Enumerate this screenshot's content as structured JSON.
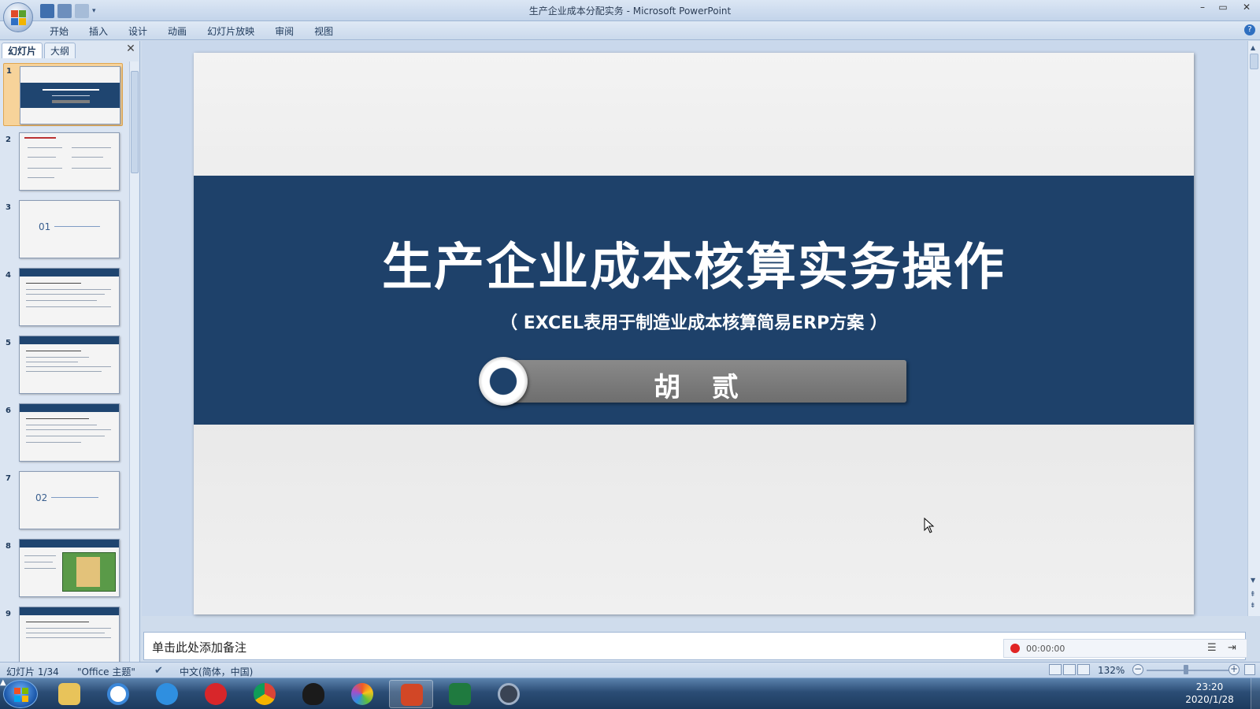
{
  "window": {
    "title": "生产企业成本分配实务 - Microsoft PowerPoint",
    "controls": [
      "–",
      "▭",
      "✕"
    ]
  },
  "ribbon": {
    "tabs": [
      "开始",
      "插入",
      "设计",
      "动画",
      "幻灯片放映",
      "审阅",
      "视图"
    ],
    "help": "?"
  },
  "panel": {
    "tabs": [
      "幻灯片",
      "大纲"
    ],
    "close": "✕",
    "thumbnails": [
      {
        "num": "1",
        "text": ""
      },
      {
        "num": "2",
        "text": ""
      },
      {
        "num": "3",
        "text": "01"
      },
      {
        "num": "4",
        "text": ""
      },
      {
        "num": "5",
        "text": ""
      },
      {
        "num": "6",
        "text": ""
      },
      {
        "num": "7",
        "text": "02"
      },
      {
        "num": "8",
        "text": ""
      },
      {
        "num": "9",
        "text": ""
      }
    ]
  },
  "slide": {
    "title": "生产企业成本核算实务操作",
    "subtitle": "（ EXCEL表用于制造业成本核算简易ERP方案 ）",
    "author": "胡 贰"
  },
  "notes": {
    "placeholder": "单击此处添加备注"
  },
  "recorder": {
    "time": "00:00:00"
  },
  "status": {
    "slide": "幻灯片 1/34",
    "theme": "\"Office 主题\"",
    "language": "中文(简体，中国)",
    "zoom": "132%"
  },
  "taskbar": {
    "apps": [
      "explorer",
      "photos",
      "chat",
      "netease-music",
      "chrome",
      "qq",
      "browser",
      "powerpoint",
      "excel",
      "camera"
    ],
    "active_app": "powerpoint",
    "time": "23:20",
    "date": "2020/1/28"
  },
  "colors": {
    "slide_band": "#1e416a",
    "thumb_selected": "#f7d39a",
    "record_dot": "#e02424"
  }
}
